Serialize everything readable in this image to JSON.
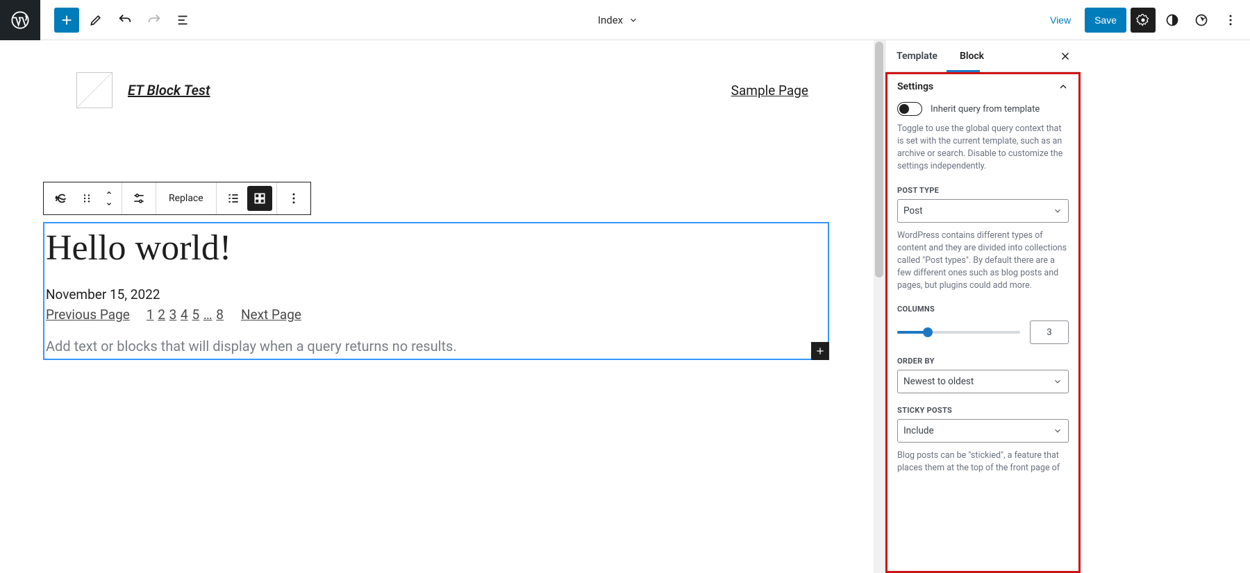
{
  "topbar": {
    "doc_label": "Index",
    "view": "View",
    "save": "Save"
  },
  "site": {
    "title": "ET Block Test",
    "nav_link": "Sample Page"
  },
  "toolbar": {
    "replace": "Replace"
  },
  "post": {
    "title": "Hello world!",
    "date": "November 15, 2022",
    "prev": "Previous Page",
    "next": "Next Page",
    "pages": [
      "1",
      "2",
      "3",
      "4",
      "5",
      "…",
      "8"
    ],
    "no_results": "Add text or blocks that will display when a query returns no results."
  },
  "sidebar": {
    "tab_template": "Template",
    "tab_block": "Block",
    "section": "Settings",
    "inherit_label": "Inherit query from template",
    "inherit_help": "Toggle to use the global query context that is set with the current template, such as an archive or search. Disable to customize the settings independently.",
    "post_type_label": "POST TYPE",
    "post_type_value": "Post",
    "post_type_help": "WordPress contains different types of content and they are divided into collections called \"Post types\". By default there are a few different ones such as blog posts and pages, but plugins could add more.",
    "columns_label": "COLUMNS",
    "columns_value": "3",
    "order_label": "ORDER BY",
    "order_value": "Newest to oldest",
    "sticky_label": "STICKY POSTS",
    "sticky_value": "Include",
    "sticky_help": "Blog posts can be \"stickied\", a feature that places them at the top of the front page of"
  }
}
